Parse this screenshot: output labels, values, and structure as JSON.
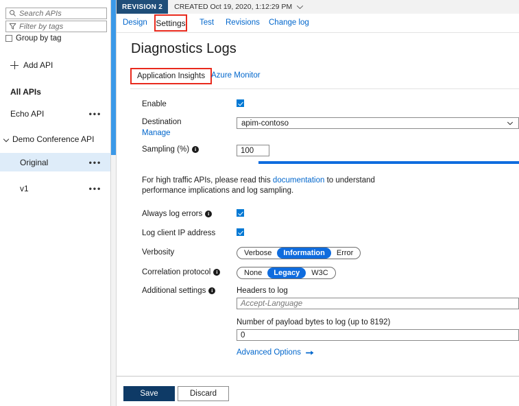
{
  "sidebar": {
    "search": {
      "placeholder": "Search APIs",
      "icon": "search-icon"
    },
    "filter": {
      "placeholder": "Filter by tags",
      "icon": "filter-icon"
    },
    "group_by_tag": {
      "label": "Group by tag",
      "checked": false
    },
    "add_api": {
      "label": "Add API",
      "icon": "plus-icon"
    },
    "items": [
      {
        "label": "All APIs",
        "bold": true,
        "menu": "•••",
        "selected": false
      },
      {
        "label": "Echo API",
        "bold": false,
        "menu": "•••",
        "selected": false
      },
      {
        "label": "Demo Conference API",
        "bold": false,
        "menu": "",
        "selected": false,
        "expanded": true
      },
      {
        "label": "Original",
        "bold": false,
        "menu": "•••",
        "selected": true
      },
      {
        "label": "v1",
        "bold": false,
        "menu": "•••",
        "selected": false
      }
    ]
  },
  "header": {
    "revision_badge": "REVISION 2",
    "created_text": "CREATED Oct 19, 2020, 1:12:29 PM",
    "chevron_icon": "chevron-down-icon"
  },
  "tabs": [
    {
      "label": "Design",
      "active": false
    },
    {
      "label": "Settings",
      "active": true,
      "highlighted": true
    },
    {
      "label": "Test",
      "active": false
    },
    {
      "label": "Revisions",
      "active": false
    },
    {
      "label": "Change log",
      "active": false
    }
  ],
  "page": {
    "title": "Diagnostics Logs"
  },
  "subtabs": [
    {
      "label": "Application Insights",
      "active": true,
      "highlighted": true
    },
    {
      "label": "Azure Monitor",
      "active": false
    }
  ],
  "form": {
    "enable": {
      "label": "Enable",
      "checked": true
    },
    "destination": {
      "label": "Destination",
      "value": "apim-contoso",
      "manage_link": "Manage",
      "chevron_icon": "chevron-down-icon"
    },
    "sampling": {
      "label": "Sampling (%)",
      "info_icon": "info-icon",
      "value": "100",
      "slider_percent": 100
    },
    "help": {
      "before": "For high traffic APIs, please read this ",
      "link": "documentation",
      "after": " to understand performance implications and log sampling."
    },
    "always_log_errors": {
      "label": "Always log errors",
      "info_icon": "info-icon",
      "checked": true
    },
    "log_client_ip": {
      "label": "Log client IP address",
      "checked": true
    },
    "verbosity": {
      "label": "Verbosity",
      "options": [
        "Verbose",
        "Information",
        "Error"
      ],
      "selected": "Information"
    },
    "correlation_protocol": {
      "label": "Correlation protocol",
      "info_icon": "info-icon",
      "options": [
        "None",
        "Legacy",
        "W3C"
      ],
      "selected": "Legacy"
    },
    "additional_settings": {
      "label": "Additional settings",
      "info_icon": "info-icon",
      "headers_to_log": {
        "label": "Headers to log",
        "value": "",
        "placeholder": "Accept-Language"
      },
      "payload_bytes": {
        "label": "Number of payload bytes to log (up to 8192)",
        "value": "0"
      },
      "advanced_options": {
        "label": "Advanced Options",
        "icon": "arrow-right-icon"
      }
    }
  },
  "footer": {
    "save_label": "Save",
    "discard_label": "Discard"
  },
  "colors": {
    "accent_blue": "#0066cc",
    "selected_pill": "#0f6cde",
    "revision_badge": "#1f4e79",
    "highlight_red": "#e8291c",
    "save_button": "#0e3a66",
    "row_selected": "#deecf9",
    "scrollbar": "#3b99e8"
  }
}
